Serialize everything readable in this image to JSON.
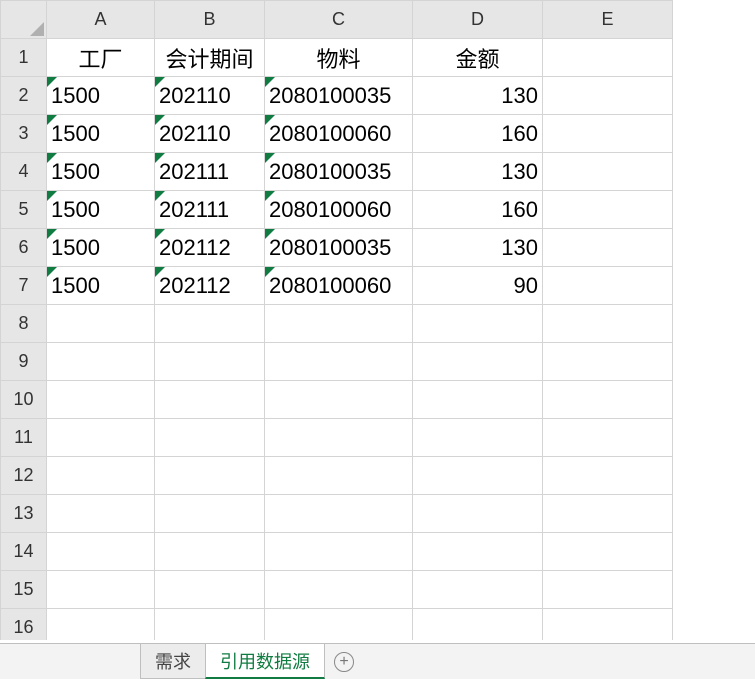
{
  "columns": [
    "A",
    "B",
    "C",
    "D",
    "E"
  ],
  "row_numbers": [
    1,
    2,
    3,
    4,
    5,
    6,
    7,
    8,
    9,
    10,
    11,
    12,
    13,
    14,
    15,
    16
  ],
  "headers": {
    "A": "工厂",
    "B": "会计期间",
    "C": "物料",
    "D": "金额",
    "E": ""
  },
  "rows": [
    {
      "A": "1500",
      "B": "202110",
      "C": "2080100035",
      "D": 130
    },
    {
      "A": "1500",
      "B": "202110",
      "C": "2080100060",
      "D": 160
    },
    {
      "A": "1500",
      "B": "202111",
      "C": "2080100035",
      "D": 130
    },
    {
      "A": "1500",
      "B": "202111",
      "C": "2080100060",
      "D": 160
    },
    {
      "A": "1500",
      "B": "202112",
      "C": "2080100035",
      "D": 130
    },
    {
      "A": "1500",
      "B": "202112",
      "C": "2080100060",
      "D": 90
    }
  ],
  "tabs": [
    {
      "label": "需求",
      "active": false
    },
    {
      "label": "引用数据源",
      "active": true
    }
  ],
  "colors": {
    "accent": "#107c41",
    "grid": "#d4d4d4",
    "header_bg": "#e6e6e6"
  }
}
